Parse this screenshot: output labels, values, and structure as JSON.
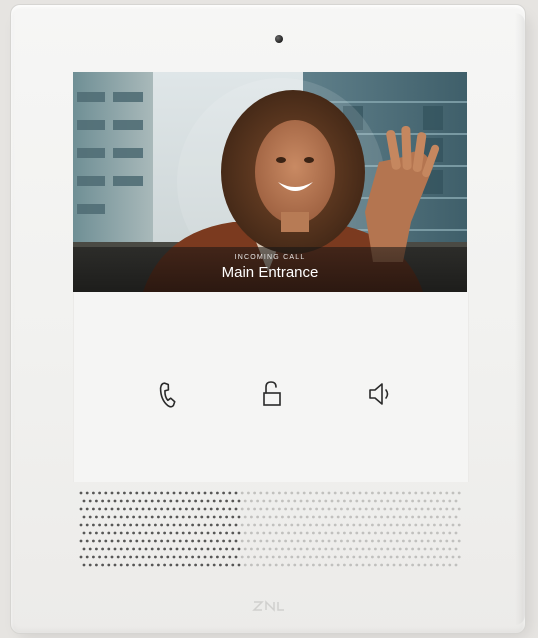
{
  "call": {
    "status": "INCOMING CALL",
    "location": "Main Entrance"
  },
  "controls": [
    {
      "name": "answer-call",
      "icon": "phone-icon"
    },
    {
      "name": "unlock-door",
      "icon": "unlock-icon"
    },
    {
      "name": "speaker-volume",
      "icon": "speaker-icon"
    }
  ],
  "colors": {
    "device": "#f3f3f2",
    "icon_stroke": "#2a2a2a",
    "call_text": "#ffffff"
  }
}
